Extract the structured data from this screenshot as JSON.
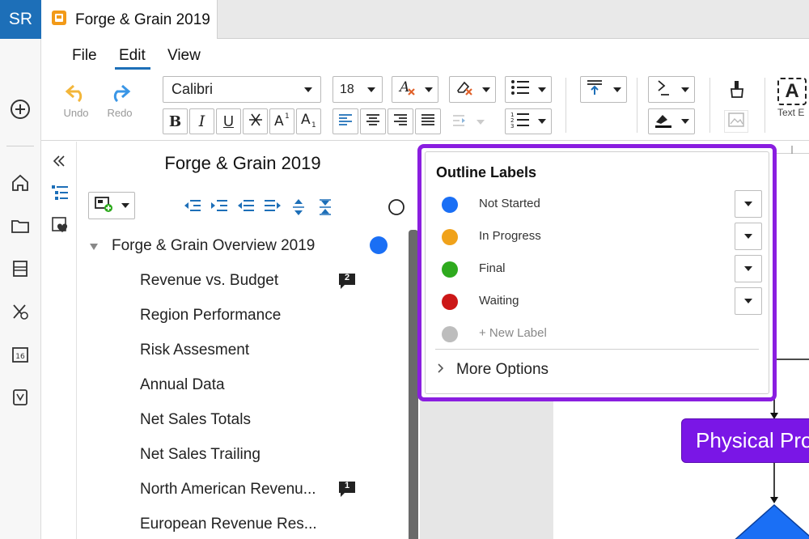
{
  "user": {
    "initials": "SR"
  },
  "tab": {
    "title": "Forge & Grain 2019"
  },
  "menu": {
    "file": "File",
    "edit": "Edit",
    "view": "View"
  },
  "toolbar": {
    "undo": "Undo",
    "redo": "Redo",
    "font": "Calibri",
    "font_size": "18",
    "text_label": "Text E"
  },
  "outline": {
    "title": "Forge & Grain 2019",
    "root": {
      "label": "Forge & Grain Overview 2019",
      "dot_color": "#1a6ff5"
    },
    "items": [
      {
        "label": "Revenue vs. Budget",
        "comments": "2"
      },
      {
        "label": "Region Performance"
      },
      {
        "label": "Risk Assesment"
      },
      {
        "label": "Annual Data"
      },
      {
        "label": "Net Sales Totals"
      },
      {
        "label": "Net Sales Trailing"
      },
      {
        "label": "North American Revenu...",
        "comments": "1"
      },
      {
        "label": "European Revenue Res..."
      }
    ]
  },
  "popup": {
    "title": "Outline Labels",
    "labels": [
      {
        "name": "Not Started",
        "color": "#1a6ff5"
      },
      {
        "name": "In Progress",
        "color": "#f0a21a"
      },
      {
        "name": "Final",
        "color": "#2eaa1e"
      },
      {
        "name": "Waiting",
        "color": "#cc1717"
      }
    ],
    "new_label": "+ New Label",
    "more_options": "More Options"
  },
  "canvas": {
    "process_label": "Physical Pro",
    "process_color": "#7a16e6",
    "diamond_color": "#1a6ff5"
  },
  "colors": {
    "accent": "#1d6fb8",
    "highlight": "#8a1ee0"
  }
}
